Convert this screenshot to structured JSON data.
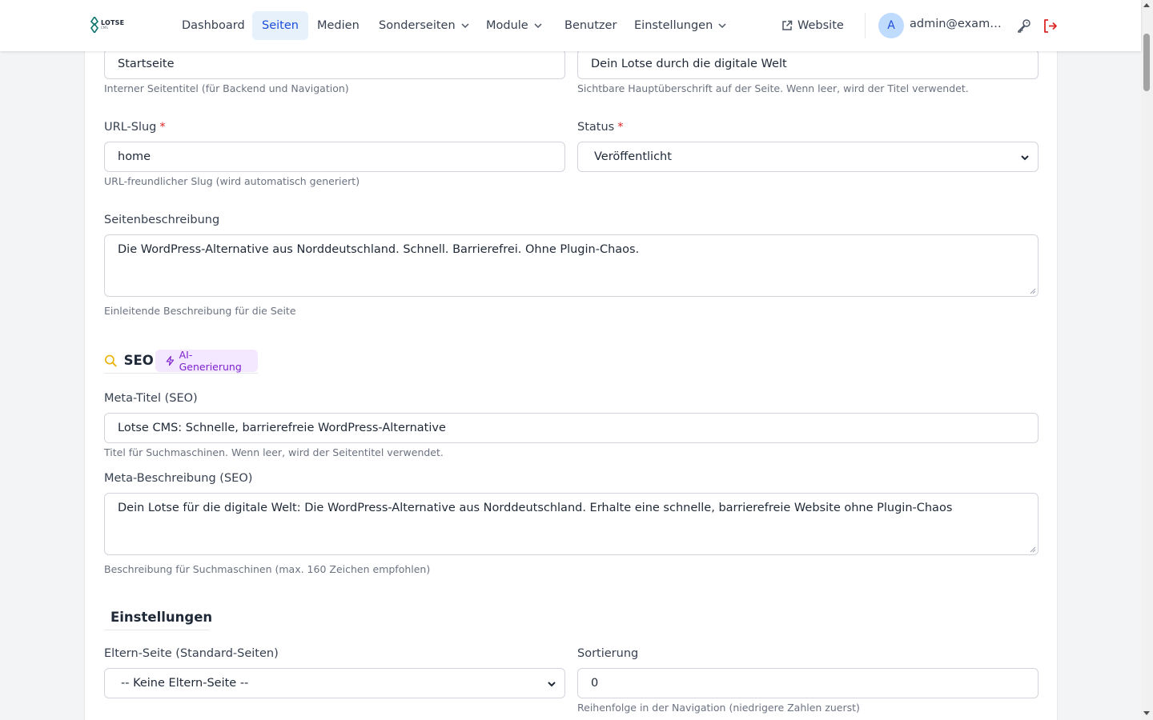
{
  "navbar": {
    "logo": {
      "name": "LOTSE",
      "sub": "CMS"
    },
    "items": [
      {
        "label": "Dashboard"
      },
      {
        "label": "Seiten",
        "active": true
      },
      {
        "label": "Medien"
      },
      {
        "label": "Sonderseiten",
        "dropdown": true
      },
      {
        "label": "Module",
        "dropdown": true
      },
      {
        "label": "Benutzer"
      },
      {
        "label": "Einstellungen",
        "dropdown": true
      }
    ],
    "website_label": "Website",
    "avatar_initial": "A",
    "user_email": "admin@example.com"
  },
  "form": {
    "title": {
      "value": "Startseite",
      "help": "Interner Seitentitel (für Backend und Navigation)"
    },
    "heading": {
      "value": "Dein Lotse durch die digitale Welt",
      "help": "Sichtbare Hauptüberschrift auf der Seite. Wenn leer, wird der Titel verwendet."
    },
    "slug": {
      "label": "URL-Slug",
      "required_mark": "*",
      "value": "home",
      "help": "URL-freundlicher Slug (wird automatisch generiert)"
    },
    "status": {
      "label": "Status",
      "required_mark": "*",
      "value": "Veröffentlicht"
    },
    "description": {
      "label": "Seitenbeschreibung",
      "value": "Die WordPress-Alternative aus Norddeutschland. Schnell. Barrierefrei. Ohne Plugin-Chaos.",
      "help": "Einleitende Beschreibung für die Seite"
    },
    "seo_section": {
      "title": "SEO",
      "badge": "AI-Generierung"
    },
    "meta_title": {
      "label": "Meta-Titel (SEO)",
      "value": "Lotse CMS: Schnelle, barrierefreie WordPress-Alternative",
      "help": "Titel für Suchmaschinen. Wenn leer, wird der Seitentitel verwendet."
    },
    "meta_description": {
      "label": "Meta-Beschreibung (SEO)",
      "value": "Dein Lotse für die digitale Welt: Die WordPress-Alternative aus Norddeutschland. Erhalte eine schnelle, barrierefreie Website ohne Plugin-Chaos",
      "help": "Beschreibung für Suchmaschinen (max. 160 Zeichen empfohlen)"
    },
    "settings_section": {
      "title": "Einstellungen"
    },
    "parent": {
      "label": "Eltern-Seite (Standard-Seiten)",
      "value": "-- Keine Eltern-Seite --"
    },
    "sort": {
      "label": "Sortierung",
      "value": "0",
      "help": "Reihenfolge in der Navigation (niedrigere Zahlen zuerst)"
    }
  },
  "colors": {
    "accent": "#1d4ed8",
    "active_bg": "#e6f1fb",
    "danger": "#dc2626",
    "seo_icon": "#eab308",
    "settings_icon": "#16a34a",
    "badge_bg": "#f3e8ff",
    "badge_text": "#7e22ce"
  },
  "icons": [
    "lotse-logo-icon",
    "chevron-down-icon",
    "external-link-icon",
    "key-icon",
    "logout-icon",
    "search-icon",
    "lightning-icon",
    "gear-icon",
    "resize-handle-icon"
  ]
}
